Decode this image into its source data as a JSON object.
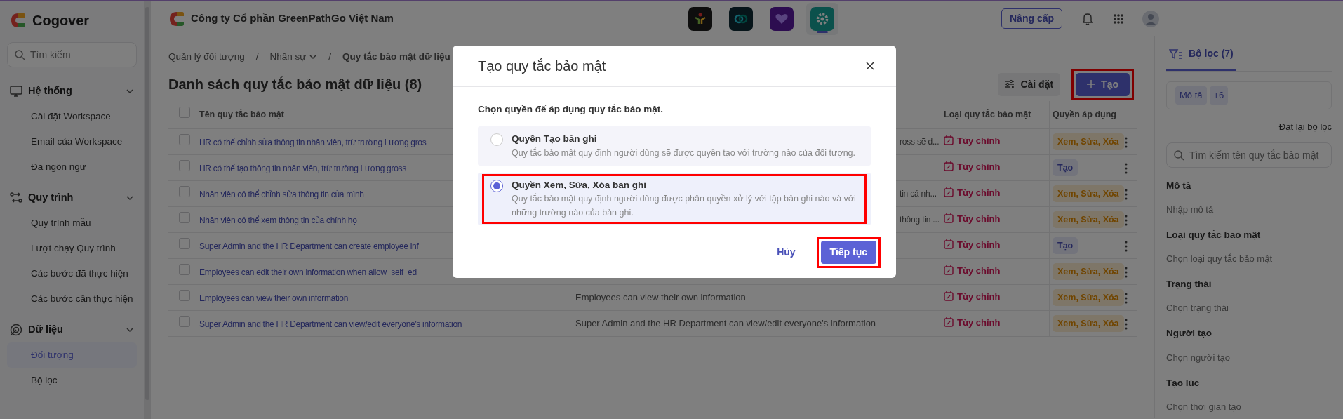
{
  "sidebar": {
    "brand": "Cogover",
    "search_placeholder": "Tìm kiếm",
    "sections": [
      {
        "title": "Hệ thống",
        "kind": "monitor",
        "expanded": true,
        "items": [
          {
            "label": "Cài đặt Workspace",
            "selected": false
          },
          {
            "label": "Email của Workspace",
            "selected": false
          },
          {
            "label": "Đa ngôn ngữ",
            "selected": false
          }
        ]
      },
      {
        "title": "Quy trình",
        "kind": "flow",
        "expanded": true,
        "items": [
          {
            "label": "Quy trình mẫu",
            "selected": false
          },
          {
            "label": "Lượt chạy Quy trình",
            "selected": false
          },
          {
            "label": "Các bước đã thực hiện",
            "selected": false
          },
          {
            "label": "Các bước cần thực hiện",
            "selected": false
          }
        ]
      },
      {
        "title": "Dữ liệu",
        "kind": "data",
        "expanded": true,
        "items": [
          {
            "label": "Đối tượng",
            "selected": true
          },
          {
            "label": "Bộ lọc",
            "selected": false
          }
        ]
      }
    ]
  },
  "header": {
    "company": "Công ty Cổ phần GreenPathGo Việt Nam",
    "apps": [
      {
        "kind": "people",
        "selected": false
      },
      {
        "kind": "link",
        "selected": false
      },
      {
        "kind": "heart",
        "selected": false
      },
      {
        "kind": "gear",
        "selected": true
      }
    ],
    "upgrade_button": "Nâng cấp"
  },
  "breadcrumb": [
    {
      "label": "Quản lý đối tượng",
      "dropdown": false,
      "current": false
    },
    {
      "separator": "/",
      "label": "Nhân sự",
      "dropdown": true,
      "current": false
    },
    {
      "separator": "/",
      "label": "Quy tắc bảo mật dữ liệu",
      "dropdown": false,
      "current": true
    }
  ],
  "page_title": "Danh sách quy tắc bảo mật dữ liệu (8)",
  "settings_button": "Cài đặt",
  "create_button": {
    "label": "Tạo",
    "highlighted": true
  },
  "table": {
    "header_checked": false,
    "columns": {
      "name": "Tên quy tắc bảo mật",
      "type": "Loại quy tắc bảo mật",
      "permission": "Quyền áp dụng"
    },
    "rows": [
      {
        "checked": false,
        "name": "HR có thể chỉnh sửa thông tin nhân viên, trừ trường Lương gros",
        "description": "ross sẽ d...",
        "covered": true,
        "type": "Tùy chỉnh",
        "permission": {
          "label": "Xem, Sửa, Xóa",
          "kind": "edit"
        }
      },
      {
        "checked": false,
        "name": "HR có thể tạo thông tin nhân viên, trừ trường Lương gross",
        "type": "Tùy chỉnh",
        "permission": {
          "label": "Tạo",
          "kind": "create"
        }
      },
      {
        "checked": false,
        "name": "Nhân viên có thể chỉnh sửa thông tin của mình",
        "description": "tin cá nh...",
        "covered": true,
        "type": "Tùy chỉnh",
        "permission": {
          "label": "Xem, Sửa, Xóa",
          "kind": "edit"
        }
      },
      {
        "checked": false,
        "name": "Nhân viên có thể xem thông tin của chính họ",
        "description": "thông tin ...",
        "covered": true,
        "type": "Tùy chỉnh",
        "permission": {
          "label": "Xem, Sửa, Xóa",
          "kind": "edit"
        }
      },
      {
        "checked": false,
        "name": "Super Admin and the HR Department can create employee inf",
        "type": "Tùy chỉnh",
        "permission": {
          "label": "Tạo",
          "kind": "create"
        }
      },
      {
        "checked": false,
        "name": "Employees can edit their own information when allow_self_ed",
        "type": "Tùy chỉnh",
        "permission": {
          "label": "Xem, Sửa, Xóa",
          "kind": "edit"
        }
      },
      {
        "checked": false,
        "name": "Employees can view their own information",
        "description": "Employees can view their own information",
        "covered": false,
        "type": "Tùy chỉnh",
        "permission": {
          "label": "Xem, Sửa, Xóa",
          "kind": "edit"
        }
      },
      {
        "checked": false,
        "name": "Super Admin and the HR Department can view/edit everyone's information",
        "description": "Super Admin and the HR Department can view/edit everyone's information",
        "covered": false,
        "type": "Tùy chỉnh",
        "permission": {
          "label": "Xem, Sửa, Xóa",
          "kind": "edit"
        }
      }
    ]
  },
  "filter_panel": {
    "tab": "Bộ lọc (7)",
    "chips": [
      "Mô tả",
      "+6"
    ],
    "reset_link": "Đặt lại bộ lọc",
    "search_placeholder": "Tìm kiếm tên quy tắc bảo mật",
    "fields": [
      {
        "label": "Mô tả",
        "placeholder": "Nhập mô tả"
      },
      {
        "label": "Loại quy tắc bảo mật",
        "placeholder": "Chọn loại quy tắc bảo mật"
      },
      {
        "label": "Trạng thái",
        "placeholder": "Chọn trạng thái"
      },
      {
        "label": "Người tạo",
        "placeholder": "Chọn người tạo"
      },
      {
        "label": "Tạo lúc",
        "placeholder": "Chọn thời gian tạo"
      }
    ]
  },
  "modal": {
    "title": "Tạo quy tắc bảo mật",
    "prompt": "Chọn quyền để áp dụng quy tắc bảo mật.",
    "options": [
      {
        "title": "Quyền Tạo bản ghi",
        "description": "Quy tắc bảo mật quy định người dùng sẽ được quyền tạo với trường nào của đối tượng.",
        "selected": false,
        "highlighted": false
      },
      {
        "title": "Quyền Xem, Sửa, Xóa bản ghi",
        "description": "Quy tắc bảo mật quy định người dùng được phân quyền xử lý với tập bản ghi nào và với những trường nào của bản ghi.",
        "selected": true,
        "highlighted": true
      }
    ],
    "cancel_button": "Hủy",
    "continue_button": {
      "label": "Tiếp tục",
      "highlighted": true
    }
  }
}
